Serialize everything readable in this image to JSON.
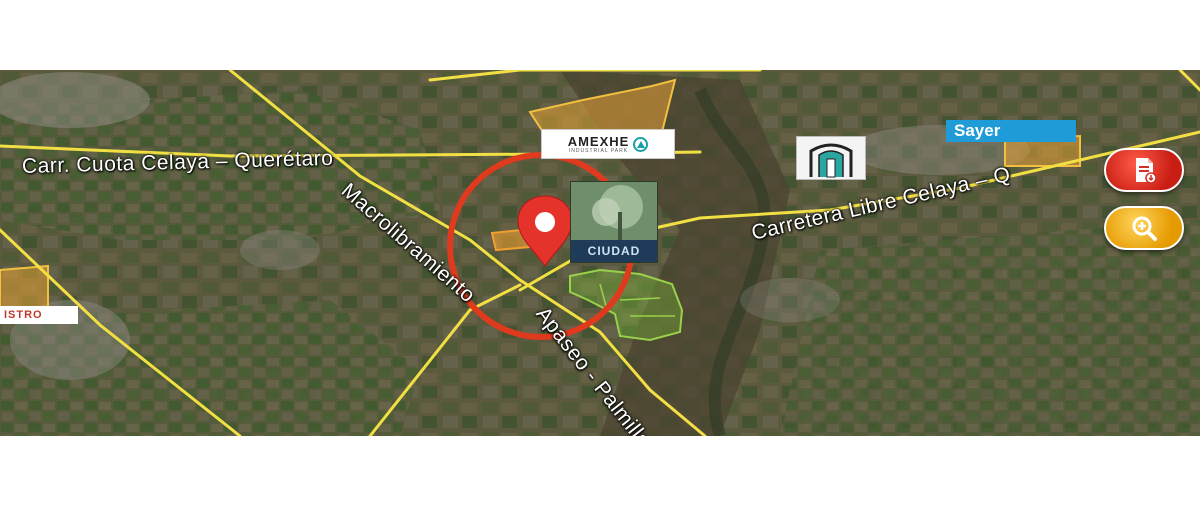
{
  "map": {
    "road_labels": {
      "cuota": "Carr. Cuota Celaya – Querétaro",
      "macrolibramiento": "Macrolibramiento",
      "apaseo": "Apaseo - Palmillas",
      "libre": "Carretera Libre Celaya – Q"
    },
    "landmarks": {
      "amexhe": "AMEXHE",
      "amexhe_sub": "INDUSTRIAL PARK",
      "sayer": "Sayer",
      "ciudad": "CIUDAD",
      "left_logo": "ISTRO"
    },
    "colors": {
      "road": "#f2df43",
      "marker": "#e5322a",
      "circle": "#e03a1e",
      "parcel_orange": "#f0a030",
      "parcel_green": "#7ec23a"
    },
    "icons": {
      "report": "document-report-icon",
      "zoom": "zoom-in-icon",
      "marker": "location-pin-icon"
    }
  }
}
